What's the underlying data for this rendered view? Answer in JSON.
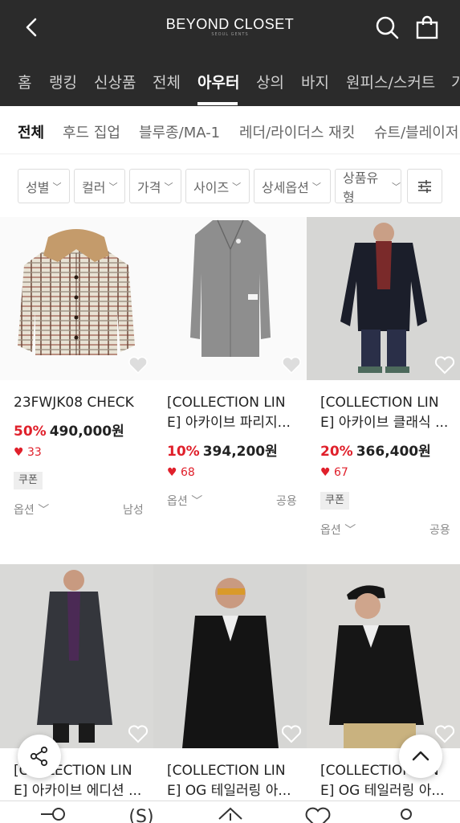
{
  "header": {
    "logo": "BEYOND CLOSET",
    "logo_sub": "SEOUL GENTS"
  },
  "categories": [
    "홈",
    "랭킹",
    "신상품",
    "전체",
    "아우터",
    "상의",
    "바지",
    "원피스/스커트",
    "가"
  ],
  "active_category": "아우터",
  "subcategories": [
    "전체",
    "후드 집업",
    "블루종/MA-1",
    "레더/라이더스 재킷",
    "슈트/블레이저"
  ],
  "filters": [
    "성별",
    "컬러",
    "가격",
    "사이즈",
    "상세옵션",
    "상품유형"
  ],
  "products": [
    {
      "name_line1": "23FWJK08 CHECK",
      "name_line2": "",
      "discount": "50%",
      "price": "490,000원",
      "likes": "33",
      "coupon": "쿠폰",
      "option": "옵션",
      "gender": "남성"
    },
    {
      "name_line1": "[COLLECTION LIN",
      "name_line2": "E] 아카이브 파리지...",
      "discount": "10%",
      "price": "394,200원",
      "likes": "68",
      "coupon": "",
      "option": "옵션",
      "gender": "공용"
    },
    {
      "name_line1": "[COLLECTION LIN",
      "name_line2": "E] 아카이브 클래식 ...",
      "discount": "20%",
      "price": "366,400원",
      "likes": "67",
      "coupon": "쿠폰",
      "option": "옵션",
      "gender": "공용"
    },
    {
      "name_line1": "[COLLECTION LIN",
      "name_line2": "E] 아카이브 에디션 ..."
    },
    {
      "name_line1": "[COLLECTION LIN",
      "name_line2": "E] OG 테일러링 아..."
    },
    {
      "name_line1": "[COLLECTION LIN",
      "name_line2": "E] OG 테일러링 아..."
    }
  ],
  "colors": {
    "header_bg": "#2b2b2b",
    "discount": "#e0202b",
    "like_heart": "#e0202b"
  }
}
